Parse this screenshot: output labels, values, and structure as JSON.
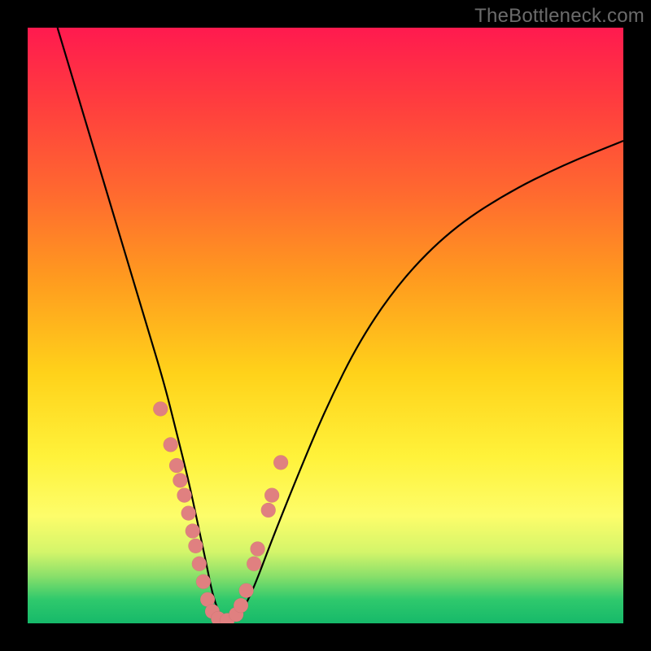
{
  "watermark": "TheBottleneck.com",
  "colors": {
    "frame": "#000000",
    "dot": "#e08080",
    "curve": "#000000"
  },
  "chart_data": {
    "type": "line",
    "title": "",
    "xlabel": "",
    "ylabel": "",
    "xlim": [
      0,
      100
    ],
    "ylim": [
      0,
      100
    ],
    "grid": false,
    "legend": false,
    "series": [
      {
        "name": "bottleneck-curve",
        "x": [
          5,
          8,
          11,
          14,
          17,
          20,
          23,
          25,
          27,
          28.5,
          30,
          31,
          32,
          33,
          34.5,
          36,
          38,
          41,
          45,
          50,
          56,
          63,
          71,
          80,
          90,
          100
        ],
        "y": [
          100,
          90,
          80,
          70,
          60,
          50,
          40,
          32,
          24,
          17,
          10,
          5,
          2,
          0.5,
          0.5,
          2,
          6,
          14,
          24,
          36,
          48,
          58,
          66,
          72,
          77,
          81
        ]
      }
    ],
    "points": {
      "name": "highlighted-dots",
      "x": [
        22.3,
        24.0,
        25.0,
        25.6,
        26.3,
        27.0,
        27.7,
        28.2,
        28.8,
        29.5,
        30.2,
        31.0,
        32.0,
        33.5,
        35.0,
        35.8,
        36.7,
        38.0,
        38.6,
        40.4,
        41.0,
        42.5
      ],
      "y": [
        36.0,
        30.0,
        26.5,
        24.0,
        21.5,
        18.5,
        15.5,
        13.0,
        10.0,
        7.0,
        4.0,
        2.0,
        0.8,
        0.5,
        1.5,
        3.0,
        5.5,
        10.0,
        12.5,
        19.0,
        21.5,
        27.0
      ]
    }
  }
}
